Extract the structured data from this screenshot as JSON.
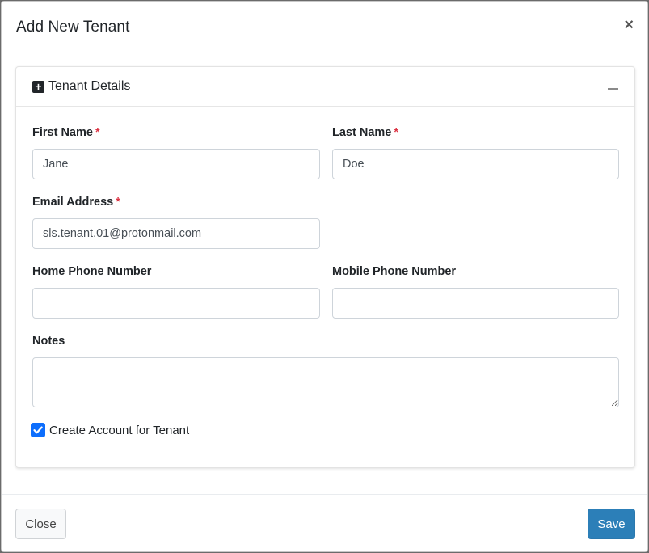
{
  "modal": {
    "title": "Add New Tenant",
    "close_glyph": "×"
  },
  "card": {
    "title": "Tenant Details",
    "plus_glyph": "+"
  },
  "form": {
    "first_name": {
      "label": "First Name",
      "required": "*",
      "value": "Jane"
    },
    "last_name": {
      "label": "Last Name",
      "required": "*",
      "value": "Doe"
    },
    "email": {
      "label": "Email Address",
      "required": "*",
      "value": "sls.tenant.01@protonmail.com"
    },
    "home_phone": {
      "label": "Home Phone Number",
      "value": ""
    },
    "mobile_phone": {
      "label": "Mobile Phone Number",
      "value": ""
    },
    "notes": {
      "label": "Notes",
      "value": ""
    },
    "create_account": {
      "label": "Create Account for Tenant",
      "checked": true
    }
  },
  "footer": {
    "close_label": "Close",
    "save_label": "Save"
  },
  "colors": {
    "primary": "#2c7fb8",
    "required": "#dc3545",
    "checkbox": "#0d6efd"
  }
}
